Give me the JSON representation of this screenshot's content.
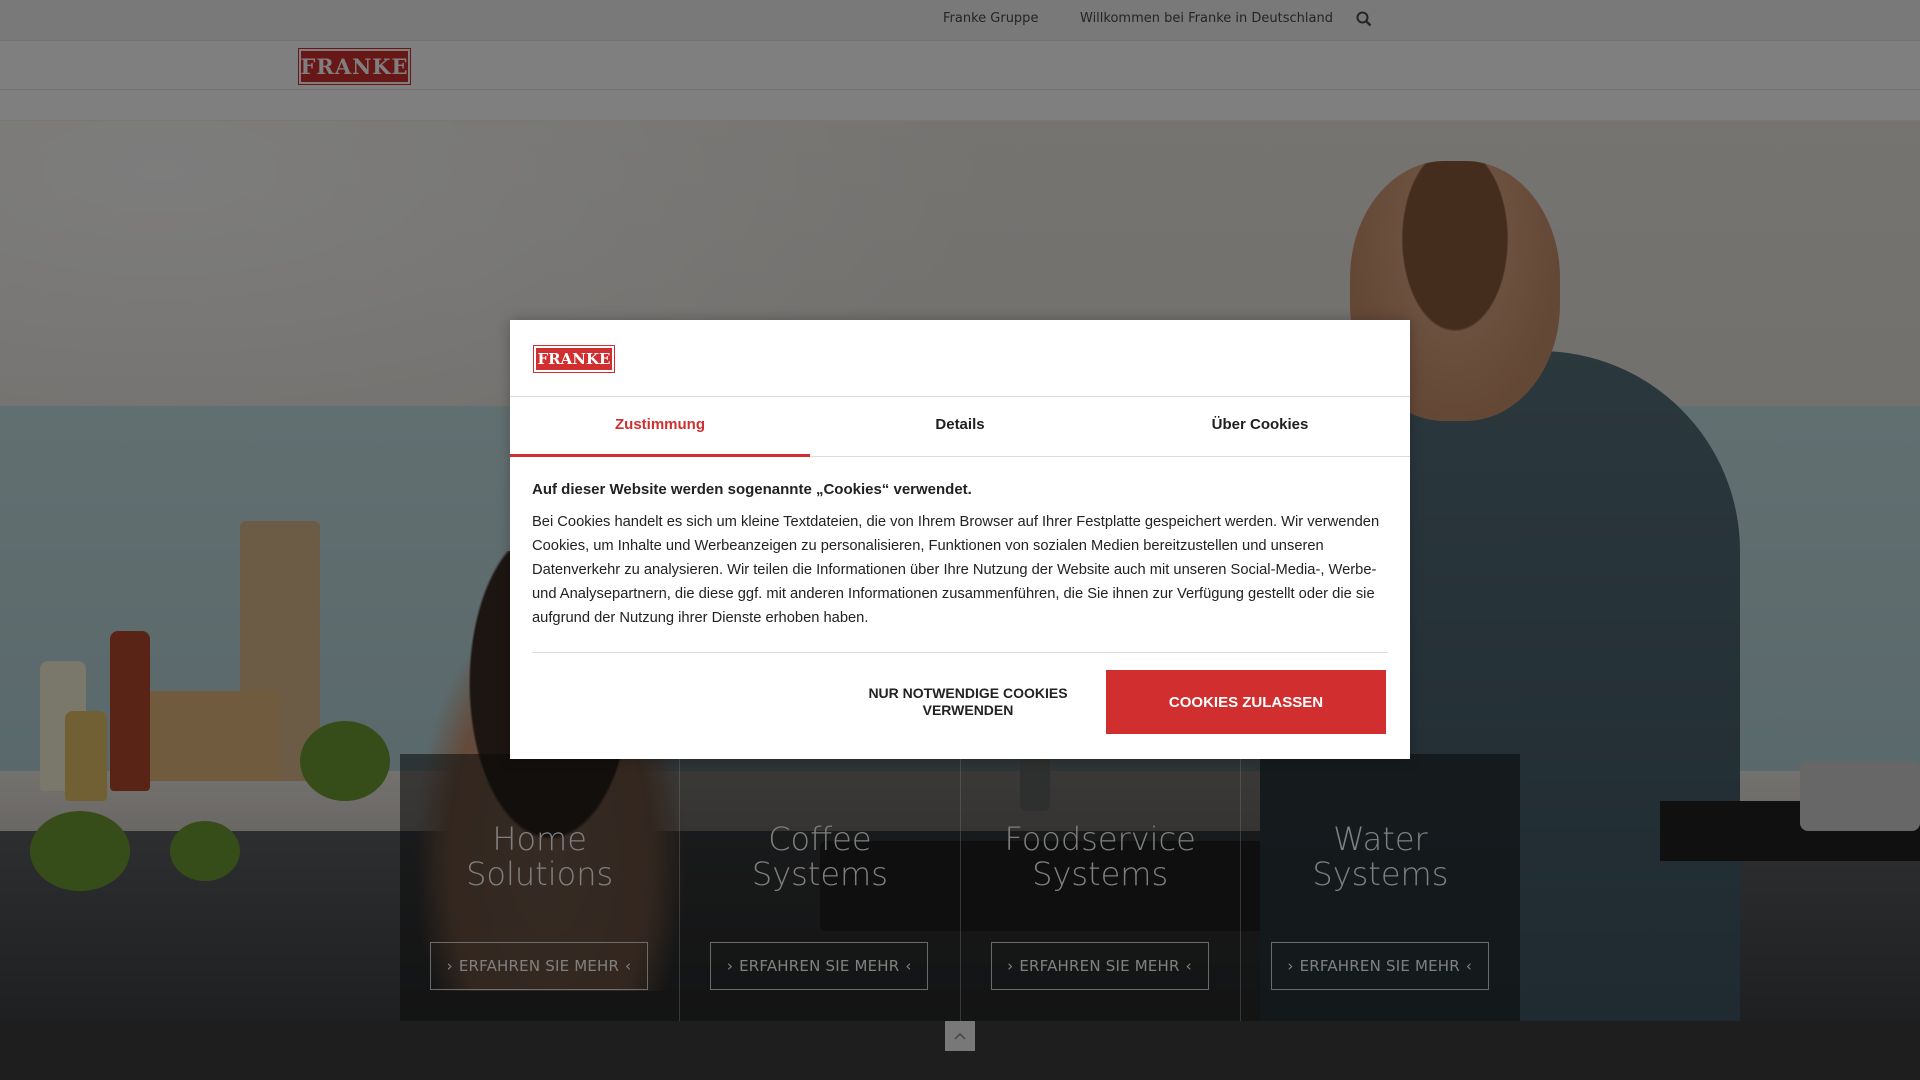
{
  "topbar": {
    "link_group": "Franke Gruppe",
    "link_welcome": "Willkommen bei Franke in Deutschland",
    "search_icon": "search-icon"
  },
  "header": {
    "logo_text": "FRANKE"
  },
  "tiles": [
    {
      "title": "Home Solutions",
      "button": "ERFAHREN SIE MEHR"
    },
    {
      "title": "Coffee Systems",
      "button": "ERFAHREN SIE MEHR"
    },
    {
      "title": "Foodservice Systems",
      "button": "ERFAHREN SIE MEHR"
    },
    {
      "title": "Water Systems",
      "button": "ERFAHREN SIE MEHR"
    }
  ],
  "scroll_top_icon": "chevron-up-icon",
  "cookie_dialog": {
    "logo_text": "FRANKE",
    "tabs": [
      "Zustimmung",
      "Details",
      "Über Cookies"
    ],
    "active_tab": "Zustimmung",
    "heading": "Auf dieser Website werden sogenannte „Cookies“ verwendet.",
    "body": "Bei Cookies handelt es sich um kleine Textdateien, die von Ihrem Browser auf Ihrer Festplatte gespeichert werden. Wir verwenden Cookies, um Inhalte und Werbeanzeigen zu personalisieren, Funktionen von sozialen Medien bereitzustellen und unseren Datenverkehr zu analysieren. Wir teilen die Informationen über Ihre Nutzung der Website auch mit unseren Social-Media-, Werbe- und Analysepartnern, die diese ggf. mit anderen Informationen zusammenführen, die Sie ihnen zur Verfügung gestellt oder die sie aufgrund der Nutzung ihrer Dienste erhoben haben.",
    "btn_necessary": "NUR NOTWENDIGE COOKIES VERWENDEN",
    "btn_allow": "COOKIES ZULASSEN"
  },
  "colors": {
    "brand_red": "#d12f2f",
    "overlay": "rgba(0,0,0,0.5)"
  }
}
